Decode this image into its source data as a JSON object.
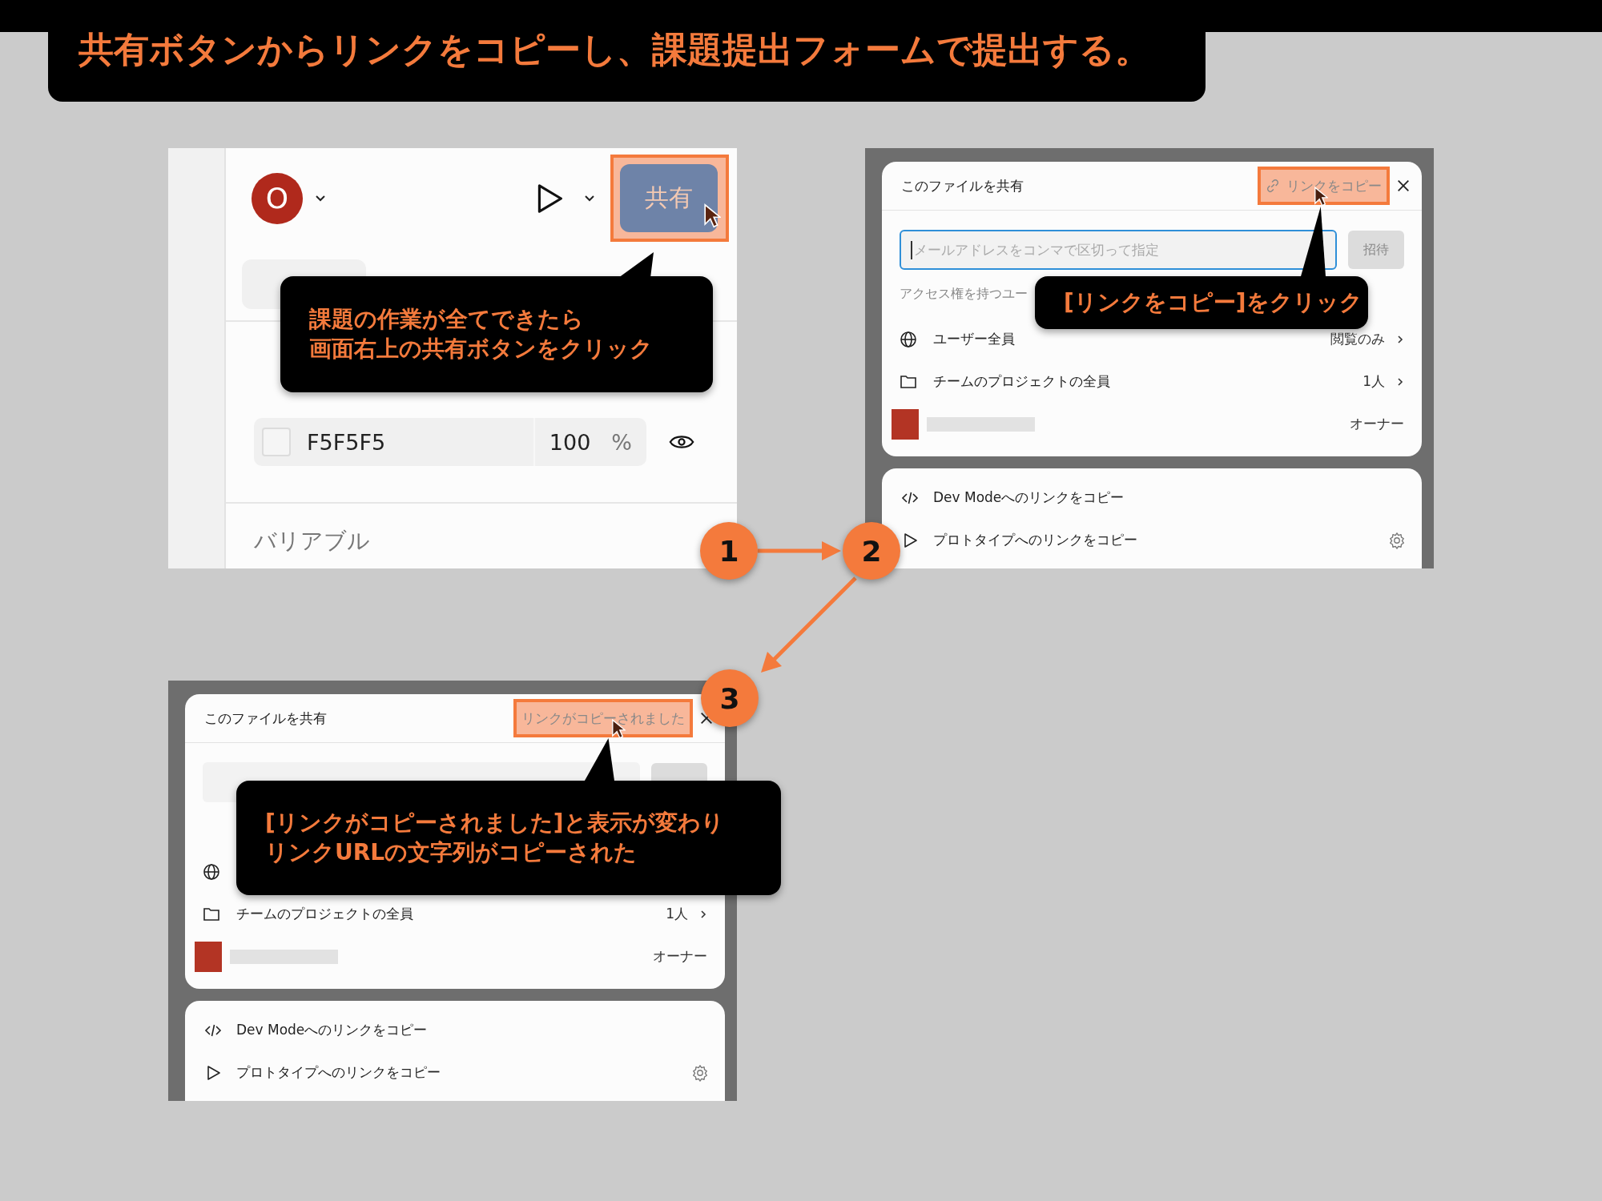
{
  "title": "共有ボタンからリンクをコピーし、課題提出フォームで提出する。",
  "design_panel": {
    "avatar_initial": "O",
    "share_button": {
      "label": "共有",
      "highlighted": true
    },
    "color_fill": {
      "hex": "F5F5F5",
      "opacity": "100",
      "unit": "%"
    },
    "section_label": "バリアブル",
    "callout": [
      "課題の作業が全てできたら",
      "画面右上の共有ボタンをクリック"
    ],
    "badge": "1"
  },
  "share_dialogs": [
    {
      "title": "このファイルを共有",
      "header_action": {
        "kind": "copy_link",
        "label": "リンクをコピー",
        "highlighted": true
      },
      "email_field": {
        "placeholder": "メールアドレスをコンマで区切って指定"
      },
      "invite_button": {
        "label": "招待",
        "disabled": true
      },
      "access_heading": "アクセス権を持つユー",
      "members": [
        {
          "kind": "everyone",
          "name": "ユーザー全員",
          "role": "閲覧のみ"
        },
        {
          "kind": "team",
          "name": "チームのプロジェクトの全員",
          "role": "1人"
        },
        {
          "kind": "owner",
          "role": "オーナー"
        }
      ],
      "links": [
        {
          "kind": "dev_mode",
          "label": "Dev Modeへのリンクをコピー"
        },
        {
          "kind": "prototype",
          "label": "プロトタイプへのリンクをコピー"
        }
      ],
      "callout": [
        "[リンクをコピー]をクリック"
      ],
      "badge": "2"
    },
    {
      "title": "このファイルを共有",
      "header_action": {
        "kind": "status",
        "label": "リンクがコピーされました",
        "highlighted": true
      },
      "invite_button": {
        "disabled": true
      },
      "members": [
        {
          "kind": "everyone"
        },
        {
          "kind": "team",
          "name": "チームのプロジェクトの全員",
          "role": "1人"
        },
        {
          "kind": "owner",
          "role": "オーナー"
        }
      ],
      "links": [
        {
          "kind": "dev_mode",
          "label": "Dev Modeへのリンクをコピー"
        },
        {
          "kind": "prototype",
          "label": "プロトタイプへのリンクをコピー"
        }
      ],
      "callout": [
        "[リンクがコピーされました]と表示が変わり",
        "リンクURLの文字列がコピーされた"
      ],
      "badge": "3"
    }
  ]
}
